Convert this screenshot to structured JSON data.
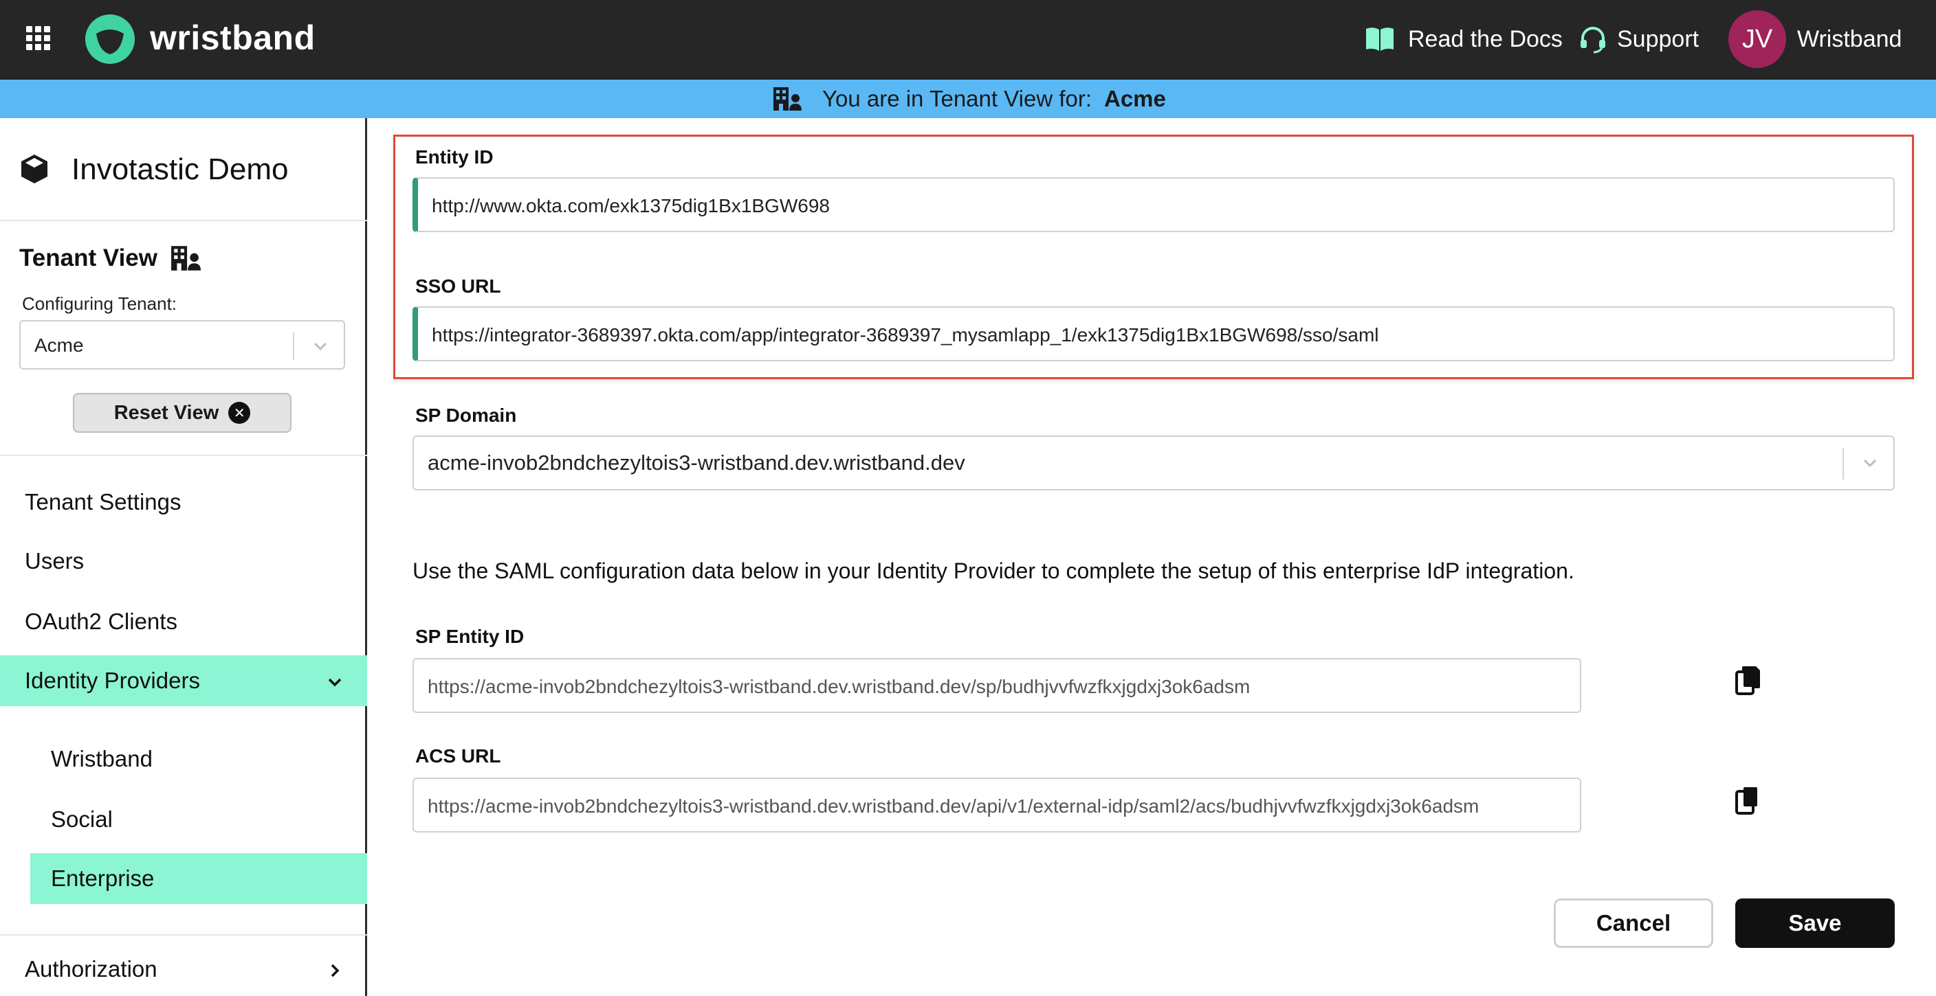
{
  "app": {
    "brand": "wristband",
    "links": {
      "docs": "Read the Docs",
      "support": "Support"
    },
    "user": {
      "initials": "JV",
      "name": "Wristband"
    },
    "colors": {
      "topbar": "#262626",
      "banner": "#5ab8f5",
      "accent": "#8cf5d3",
      "avatar": "#a0245a",
      "highlight": "#e04a3a"
    }
  },
  "banner": {
    "text": "You are in Tenant View for:",
    "tenant": "Acme"
  },
  "sidebar": {
    "app_name": "Invotastic Demo",
    "tenant_view": {
      "title": "Tenant View",
      "configuring_label": "Configuring Tenant:",
      "selected_tenant": "Acme",
      "reset_label": "Reset View"
    },
    "nav": [
      {
        "label": "Tenant Settings",
        "active": false
      },
      {
        "label": "Users",
        "active": false
      },
      {
        "label": "OAuth2 Clients",
        "active": false
      },
      {
        "label": "Identity Providers",
        "active": true,
        "expanded": true
      },
      {
        "label": "Authorization",
        "active": false
      }
    ],
    "idp_sub": [
      {
        "label": "Wristband",
        "active": false
      },
      {
        "label": "Social",
        "active": false
      },
      {
        "label": "Enterprise",
        "active": true
      }
    ]
  },
  "form": {
    "entity_id": {
      "label": "Entity ID",
      "value": "http://www.okta.com/exk1375dig1Bx1BGW698"
    },
    "sso_url": {
      "label": "SSO URL",
      "value": "https://integrator-3689397.okta.com/app/integrator-3689397_mysamlapp_1/exk1375dig1Bx1BGW698/sso/saml"
    },
    "sp_domain": {
      "label": "SP Domain",
      "value": "acme-invob2bndchezyltois3-wristband.dev.wristband.dev"
    },
    "info": "Use the SAML configuration data below in your Identity Provider to complete the setup of this enterprise IdP integration.",
    "sp_entity_id": {
      "label": "SP Entity ID",
      "value": "https://acme-invob2bndchezyltois3-wristband.dev.wristband.dev/sp/budhjvvfwzfkxjgdxj3ok6adsm"
    },
    "acs_url": {
      "label": "ACS URL",
      "value": "https://acme-invob2bndchezyltois3-wristband.dev.wristband.dev/api/v1/external-idp/saml2/acs/budhjvvfwzfkxjgdxj3ok6adsm"
    }
  },
  "actions": {
    "cancel": "Cancel",
    "save": "Save"
  }
}
